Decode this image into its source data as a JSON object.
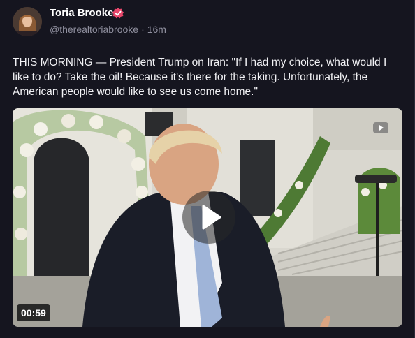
{
  "post": {
    "author": {
      "name": "Toria Brooke",
      "handle": "@therealtoriabrooke",
      "separator": "·",
      "timestamp": "16m",
      "verified_color": "#e8476b"
    },
    "text": "THIS MORNING — President Trump on Iran: \"If I had my choice, what would I like to do? Take the oil! Because it's there for the taking. Unfortunately, the American people would like to see us come home.\"",
    "media": {
      "type": "video",
      "duration": "00:59",
      "play_icon": "play-icon",
      "overlay_icon": "video-icon"
    }
  },
  "colors": {
    "background": "#15151f",
    "muted_text": "#8f8f9e"
  }
}
